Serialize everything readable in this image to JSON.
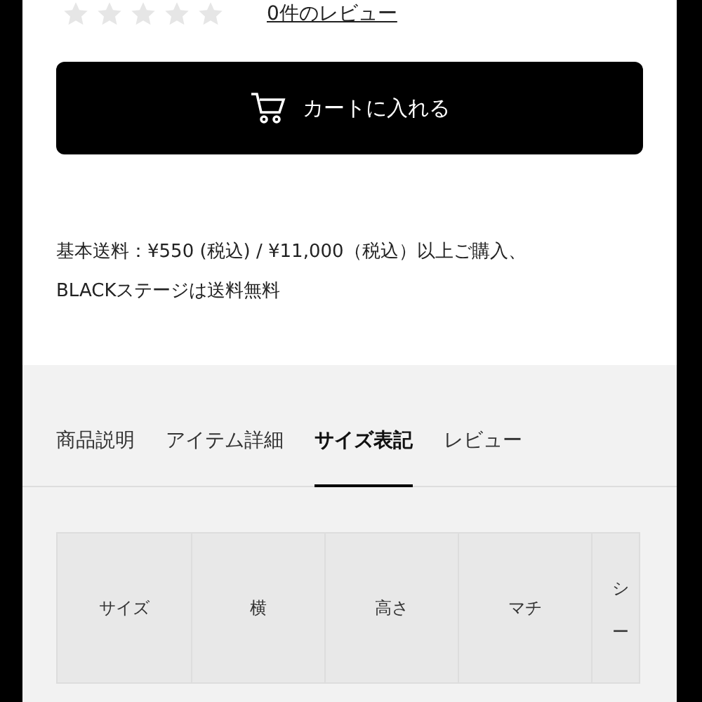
{
  "rating": {
    "stars": 0,
    "review_link": "0件のレビュー"
  },
  "cart_button": {
    "label": "カートに入れる"
  },
  "shipping_note": "基本送料：¥550 (税込) / ¥11,000（税込）以上ご購入、BLACKステージは送料無料",
  "tabs": [
    {
      "label": "商品説明",
      "selected": false
    },
    {
      "label": "アイテム詳細",
      "selected": false
    },
    {
      "label": "サイズ表記",
      "selected": true
    },
    {
      "label": "レビュー",
      "selected": false
    }
  ],
  "table": {
    "columns": [
      "サイズ",
      "横",
      "高さ",
      "マチ",
      "シー"
    ]
  }
}
